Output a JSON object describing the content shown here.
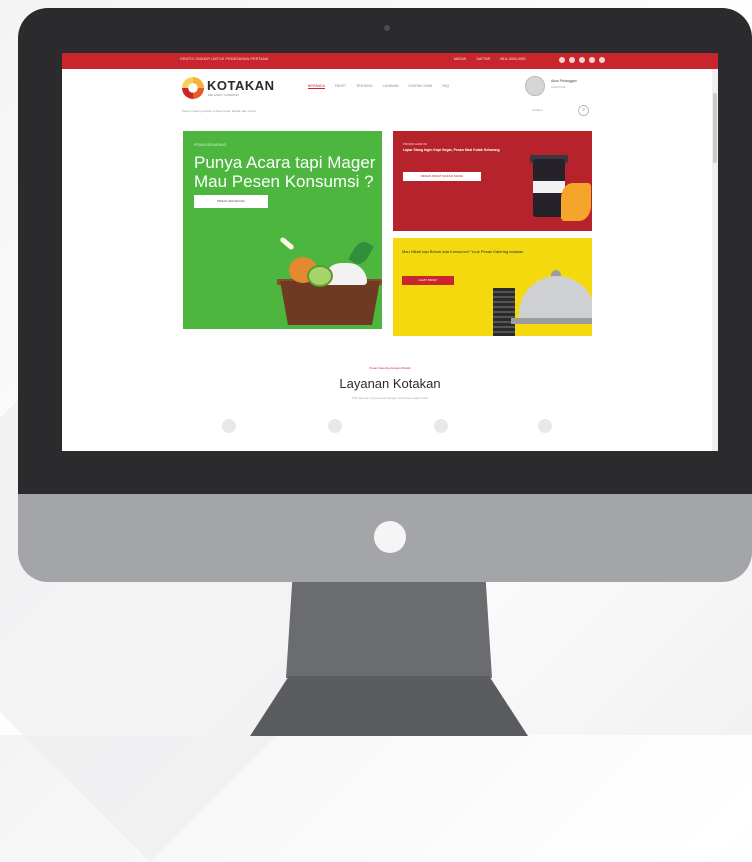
{
  "topbar": {
    "promo": "GRATIS ONGKIR UNTUK PEMESANAN PERTAMA",
    "links": [
      "MASUK",
      "DAFTAR",
      "0811-0000-0000"
    ],
    "socials": [
      "facebook-icon",
      "twitter-icon",
      "instagram-icon",
      "youtube-icon",
      "email-icon"
    ]
  },
  "header": {
    "logo": "KOTAKAN",
    "logo_sub": "DELIVERY CATERING",
    "nav": [
      "BERANDA",
      "PAKET",
      "TENTANG",
      "LAYANAN",
      "KONTAK KAMI",
      "FAQ"
    ],
    "user_name": "Akun Pelanggan",
    "user_role": "Lihat Profil"
  },
  "toolbar": {
    "breadcrumb": "Pesan Katering Online & Nasi Kotak, Mudah dan Cepat",
    "sort": "Urutkan",
    "search_icon": "search-icon"
  },
  "banner_main": {
    "label": "PESAN SEKARANG",
    "title": "Punya Acara tapi Mager Mau Pesen Konsumsi ?",
    "button": "PESAN SEKARANG"
  },
  "banner_red": {
    "label": "PROMO HARI INI",
    "text": "Lapar Siang Ingin Kopi Segar, Pesan Nasi Kotak Sekarang",
    "button": "PESAN PAKET MAKAN SIANG"
  },
  "banner_yellow": {
    "text": "Mau Nikah tapi Belum ada Konsumsi? Yuuk Pesan Katering kotakan",
    "button": "LIHAT PAKET"
  },
  "services": {
    "small": "Pesan Katering dengan Mudah",
    "title": "Layanan Kotakan",
    "sub": "Pilih layanan yang sesuai dengan kebutuhan acara Anda"
  },
  "colors": {
    "brand_red": "#c8262c",
    "green": "#4cb63f",
    "yellow": "#f4d90e",
    "bezel": "#2b2b2d"
  }
}
